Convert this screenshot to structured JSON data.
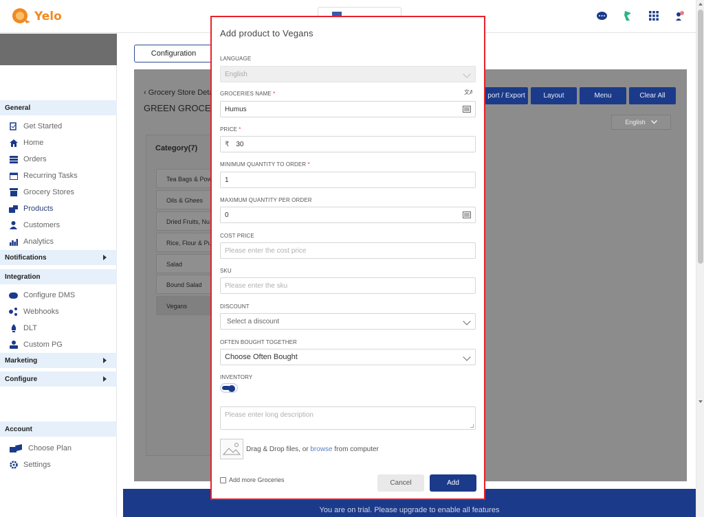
{
  "app": {
    "name": "Yelo"
  },
  "sidebar": {
    "sections": [
      {
        "label": "General",
        "items": [
          {
            "label": "Get Started",
            "icon": "get-started-icon"
          },
          {
            "label": "Home",
            "icon": "home-icon"
          },
          {
            "label": "Orders",
            "icon": "orders-icon"
          },
          {
            "label": "Recurring Tasks",
            "icon": "calendar-icon"
          },
          {
            "label": "Grocery Stores",
            "icon": "store-icon"
          },
          {
            "label": "Products",
            "icon": "products-icon",
            "active": true
          },
          {
            "label": "Customers",
            "icon": "customers-icon"
          },
          {
            "label": "Analytics",
            "icon": "analytics-icon"
          }
        ]
      },
      {
        "label": "Notifications",
        "expandable": true
      },
      {
        "label": "Integration",
        "items": [
          {
            "label": "Configure DMS",
            "icon": "dms-icon"
          },
          {
            "label": "Webhooks",
            "icon": "webhooks-icon"
          },
          {
            "label": "DLT",
            "icon": "dlt-icon"
          },
          {
            "label": "Custom PG",
            "icon": "custom-pg-icon"
          }
        ]
      },
      {
        "label": "Marketing",
        "expandable": true
      },
      {
        "label": "Configure",
        "expandable": true
      },
      {
        "label": "Account",
        "items": [
          {
            "label": "Choose Plan",
            "icon": "choose-plan-icon"
          },
          {
            "label": "Settings",
            "icon": "settings-icon"
          }
        ]
      }
    ]
  },
  "main": {
    "tab": "Configuration",
    "backlink": "‹ Grocery Store Deta",
    "title": "GREEN GROCER",
    "buttons": [
      "port / Export",
      "Layout",
      "Menu",
      "Clear All"
    ],
    "language": "English",
    "category_title": "Category(7)",
    "categories": [
      "Tea Bags & Pow",
      "Oils & Ghees",
      "Dried Fruits, Nu",
      "Rice, Flour & Pu",
      "Salad",
      "Bound Salad",
      "Vegans"
    ]
  },
  "modal": {
    "title": "Add product to Vegans",
    "language_label": "LANGUAGE",
    "language_value": "English",
    "name_label": "GROCERIES NAME",
    "name_value": "Humus",
    "price_label": "PRICE",
    "currency": "₹",
    "price_value": "30",
    "min_qty_label": "MINIMUM QUANTITY TO ORDER",
    "min_qty_value": "1",
    "max_qty_label": "MAXIMUM QUANTITY PER ORDER",
    "max_qty_value": "0",
    "cost_label": "COST PRICE",
    "cost_placeholder": "Please enter the cost price",
    "sku_label": "SKU",
    "sku_placeholder": "Please enter the sku",
    "discount_label": "DISCOUNT",
    "discount_placeholder": "Select a discount",
    "often_label": "OFTEN BOUGHT TOGETHER",
    "often_value": "Choose Often Bought",
    "inventory_label": "INVENTORY",
    "inventory_on": true,
    "description_placeholder": "Please enter long description",
    "dropzone_text": "Drag & Drop files, or",
    "dropzone_link": "browse",
    "dropzone_suffix": "from computer",
    "add_more_label": "Add more Groceries",
    "cancel_label": "Cancel",
    "add_label": "Add"
  },
  "trial_banner": "You are on trial. Please upgrade to enable all features",
  "colors": {
    "primary": "#1b3a8a",
    "brand": "#f08a24",
    "highlight_border": "#e8202a"
  }
}
